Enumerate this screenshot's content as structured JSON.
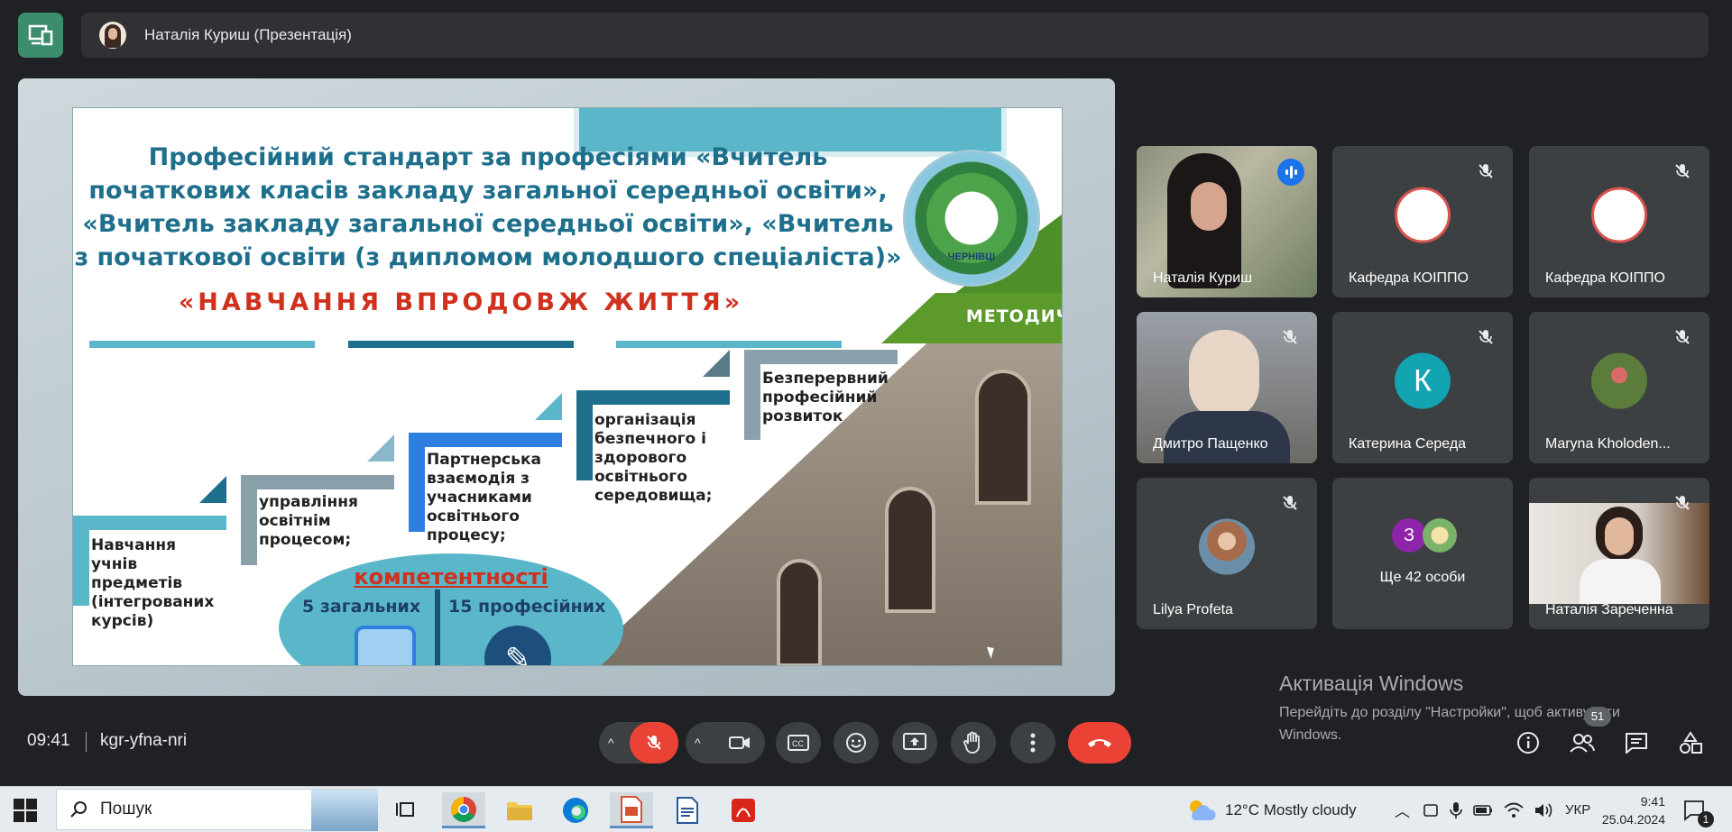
{
  "presenter": {
    "name": "Наталія Куриш (Презентація)"
  },
  "slide": {
    "title": "Професійний стандарт за професіями «Вчитель початкових класів закладу загальної середньої освіти», «Вчитель закладу загальної середньої освіти», «Вчитель з початкової освіти (з дипломом молодшого спеціаліста)»",
    "subtitle": "«НАВЧАННЯ ВПРОДОВЖ ЖИТТЯ»",
    "emblem_text": "ЧЕРНІВЦІ",
    "ribbon_text": "МЕТОДИЧ",
    "steps": [
      "Навчання учнів предметів (інтегрованих курсів)",
      "управління освітнім процесом;",
      "Партнерська взаємодія з учасниками освітнього процесу;",
      "організація безпечного і здорового освітнього середовища;",
      "Безперервний професійний розвиток"
    ],
    "competencies": {
      "title": "компетентності",
      "general": "5 загальних",
      "professional": "15 професійних"
    }
  },
  "participants": [
    {
      "name": "Наталія Куриш",
      "muted": false,
      "speaking": true,
      "type": "video"
    },
    {
      "name": "Кафедра КОІППО",
      "muted": true,
      "type": "logo"
    },
    {
      "name": "Кафедра КОІППО",
      "muted": true,
      "type": "logo"
    },
    {
      "name": "Дмитро Пащенко",
      "muted": true,
      "type": "video"
    },
    {
      "name": "Катерина Середа",
      "muted": true,
      "type": "letter",
      "letter": "К",
      "color": "#12a4b0"
    },
    {
      "name": "Maryna Kholoden...",
      "muted": true,
      "type": "photo"
    },
    {
      "name": "Lilya Profeta",
      "muted": true,
      "type": "photo"
    },
    {
      "name": "Ще 42 особи",
      "type": "more",
      "letter": "З",
      "color": "#8e24aa"
    },
    {
      "name": "Наталія Зареченна",
      "muted": true,
      "type": "video"
    }
  ],
  "bottom_bar": {
    "time": "09:41",
    "meeting_code": "kgr-yfna-nri",
    "people_count": "51"
  },
  "activation": {
    "title": "Активація Windows",
    "subtitle": "Перейдіть до розділу \"Настройки\", щоб активувати Windows."
  },
  "taskbar": {
    "search_placeholder": "Пошук",
    "weather": "12°C  Mostly cloudy",
    "language": "УКР",
    "time": "9:41",
    "date": "25.04.2024",
    "notification_count": "1"
  },
  "colors": {
    "accent": "#1a73e8",
    "end_call": "#ea4335",
    "tile": "#3c4043"
  }
}
